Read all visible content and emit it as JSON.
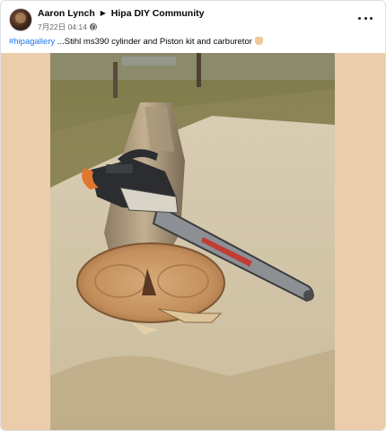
{
  "post": {
    "author": "Aaron Lynch",
    "group": "Hipa DIY Community",
    "date": "7月22日",
    "time": "04:14",
    "caption_hashtag": "#hipagallery",
    "caption_text": " ...Stihl ms390 cylinder and Piston kit and carburetor",
    "more_icon": "more-horizontal-icon",
    "privacy_icon": "globe-icon"
  },
  "photo": {
    "subject": "chainsaw on log",
    "background_color": "#eccdab"
  }
}
